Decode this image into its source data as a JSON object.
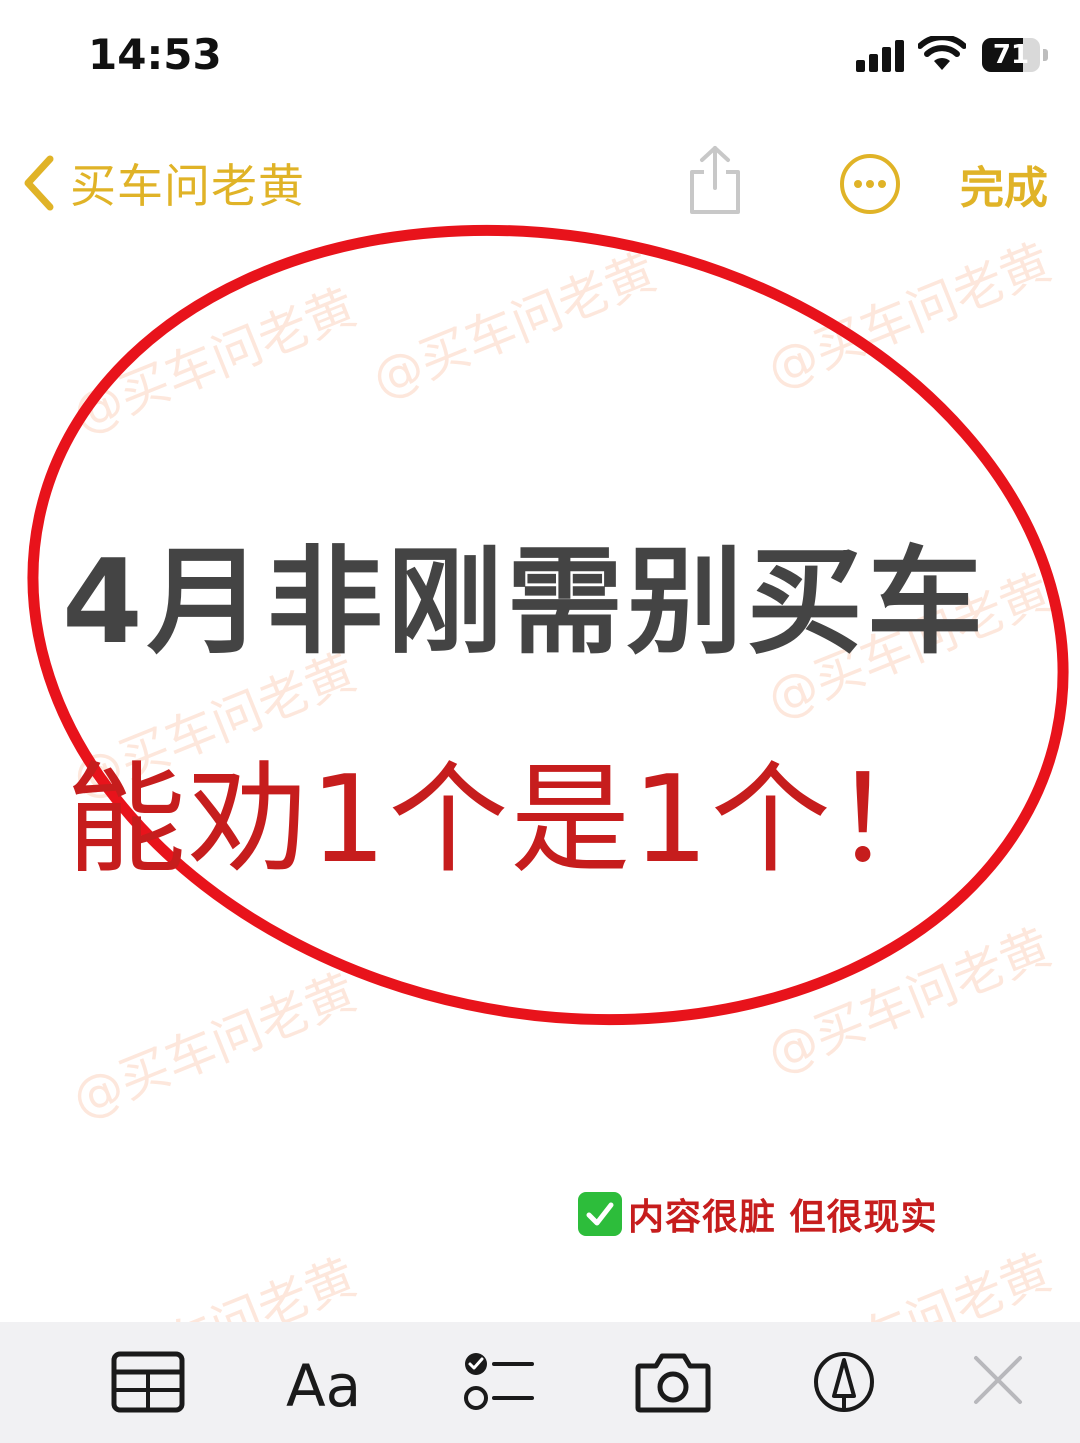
{
  "status_bar": {
    "time": "14:53",
    "battery": "71",
    "battery_level": 0.71
  },
  "nav": {
    "back_label": "买车问老黄",
    "done_label": "完成",
    "icons": [
      "chevron-left-icon",
      "share-icon",
      "more-icon"
    ]
  },
  "content": {
    "headline": "4月非刚需别买车",
    "subline": "能劝1个是1个！",
    "note": "内容很脏 但很现实",
    "note_icon": "check-mark-button-icon"
  },
  "watermark": "@买车问老黄",
  "toolbar": {
    "format_label": "Aa",
    "icons": [
      "table-icon",
      "format-text-icon",
      "checklist-icon",
      "camera-icon",
      "markup-pen-icon",
      "close-icon"
    ]
  },
  "colors": {
    "accent": "#e0b327",
    "headline": "#444444",
    "red": "#c61d1d",
    "ellipse": "#e8131b",
    "toolbar_bg": "#f1f1f3",
    "watermark": "#f4783c"
  }
}
